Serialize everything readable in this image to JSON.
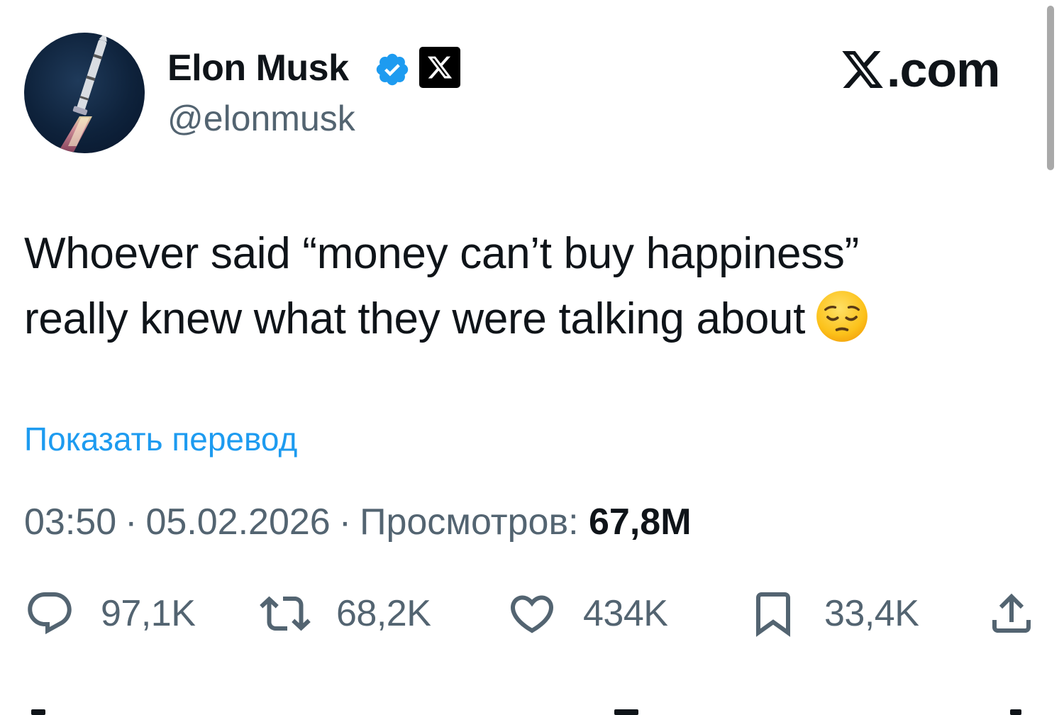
{
  "author": {
    "display_name": "Elon Musk",
    "handle": "@elonmusk",
    "avatar_icon": "rocket-avatar",
    "verified_icon": "verified-badge-icon",
    "affiliation_icon": "x-logo-icon"
  },
  "watermark": {
    "text": ".com",
    "icon": "x-logo-icon"
  },
  "tweet": {
    "text_line1": "Whoever said “money can’t buy happiness”",
    "text_line2": "really knew what they were talking about",
    "emoji": "pensive-face-emoji",
    "translate_label": "Показать перевод",
    "time": "03:50",
    "date": "05.02.2026",
    "separator": "·",
    "views_label": "Просмотров:",
    "views_count": "67,8M"
  },
  "actions": {
    "replies": "97,1K",
    "reposts": "68,2K",
    "likes": "434K",
    "bookmarks": "33,4K"
  },
  "colors": {
    "accent": "#1d9bf0",
    "text": "#0f1419",
    "secondary": "#536471",
    "verified": "#1d9bf0"
  }
}
